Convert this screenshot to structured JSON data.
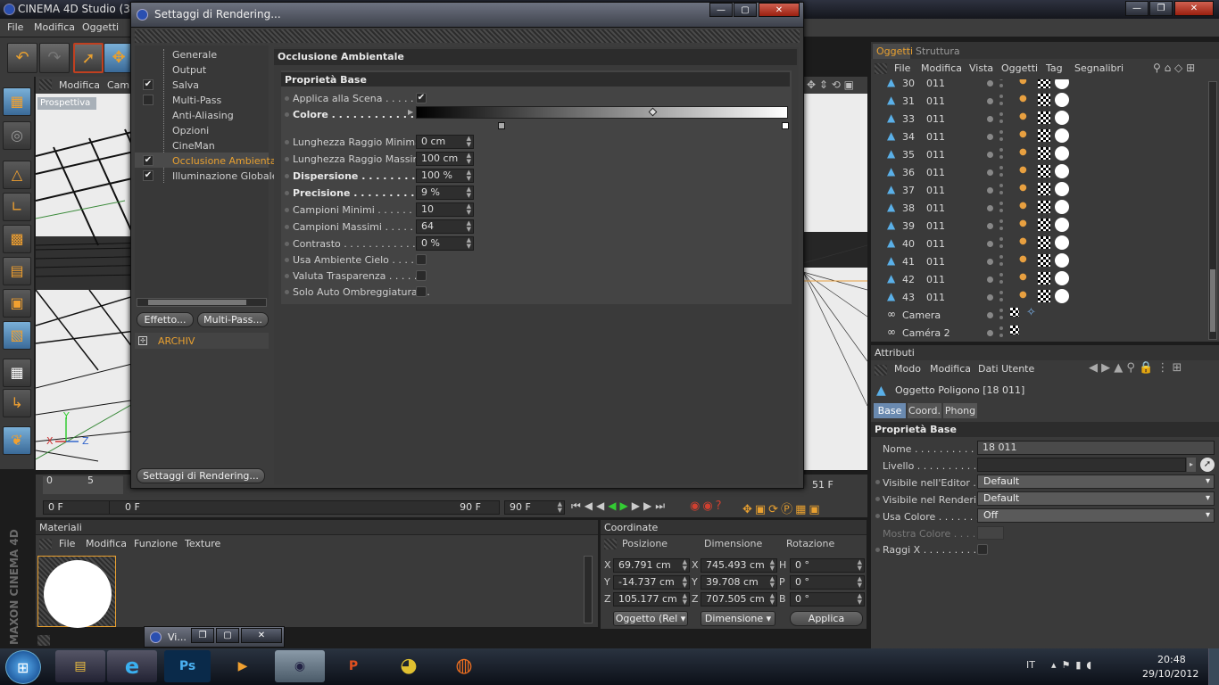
{
  "app": {
    "title": "CINEMA 4D Studio (32"
  },
  "menubar": [
    "File",
    "Modifica",
    "Oggetti"
  ],
  "viewport": {
    "menu": [
      "Modifica",
      "Cam"
    ],
    "label": "Prospettiva",
    "axes": {
      "x": "X",
      "y": "Y",
      "z": "Z"
    }
  },
  "dialog": {
    "title": "Settaggi di Rendering...",
    "nav": [
      {
        "label": "Generale",
        "checked": false,
        "active": false
      },
      {
        "label": "Output",
        "checked": false,
        "active": false
      },
      {
        "label": "Salva",
        "checked": true,
        "active": false
      },
      {
        "label": "Multi-Pass",
        "checked": false,
        "active": false,
        "box": true
      },
      {
        "label": "Anti-Aliasing",
        "checked": false,
        "active": false
      },
      {
        "label": "Opzioni",
        "checked": false,
        "active": false
      },
      {
        "label": "CineMan",
        "checked": false,
        "active": false
      },
      {
        "label": "Occlusione Ambientale",
        "checked": true,
        "active": true
      },
      {
        "label": "Illuminazione Globale",
        "checked": true,
        "active": false
      }
    ],
    "effect_button": "Effetto...",
    "multipass_button": "Multi-Pass...",
    "preset": "ARCHIV",
    "bottom_button": "Settaggi di Rendering...",
    "section_title": "Occlusione Ambientale",
    "group_title": "Proprietà Base",
    "props": {
      "applica": {
        "label": "Applica alla Scena . . . . . . .",
        "checked": true
      },
      "colore": {
        "label": "Colore . . . . . . . . . . . . . ."
      },
      "lung_min": {
        "label": "Lunghezza Raggio Minima",
        "value": "0 cm"
      },
      "lung_max": {
        "label": "Lunghezza Raggio Massima",
        "value": "100 cm"
      },
      "dispersione": {
        "label": "Dispersione . . . . . . . . . . .",
        "value": "100 %"
      },
      "precisione": {
        "label": "Precisione . . . . . . . . . . .",
        "value": "9 %"
      },
      "camp_min": {
        "label": "Campioni Minimi . . . . . . . . .",
        "value": "10"
      },
      "camp_max": {
        "label": "Campioni Massimi . . . . . . . .",
        "value": "64"
      },
      "contrasto": {
        "label": "Contrasto . . . . . . . . . . . . .",
        "value": "0 %"
      },
      "usa_cielo": {
        "label": "Usa Ambiente Cielo . . . . . .",
        "checked": false
      },
      "valuta_trasp": {
        "label": "Valuta Trasparenza . . . . . .",
        "checked": false
      },
      "solo_auto": {
        "label": "Solo Auto Ombreggiatura . .",
        "checked": false
      }
    }
  },
  "timeline": {
    "ticks": [
      "0",
      "5"
    ],
    "current": "0 F",
    "range_start": "0 F",
    "range_end": "90 F",
    "end": "90 F",
    "frame_right": "51 F"
  },
  "materials": {
    "title": "Materiali",
    "menu": [
      "File",
      "Modifica",
      "Funzione",
      "Texture"
    ]
  },
  "coordinates": {
    "title": "Coordinate",
    "headers": [
      "Posizione",
      "Dimensione",
      "Rotazione"
    ],
    "rows": [
      {
        "axis": "X",
        "pos": "69.791 cm",
        "daxis": "X",
        "dim": "745.493 cm",
        "raxis": "H",
        "rot": "0 °"
      },
      {
        "axis": "Y",
        "pos": "-14.737 cm",
        "daxis": "Y",
        "dim": "39.708 cm",
        "raxis": "P",
        "rot": "0 °"
      },
      {
        "axis": "Z",
        "pos": "105.177 cm",
        "daxis": "Z",
        "dim": "707.505 cm",
        "raxis": "B",
        "rot": "0 °"
      }
    ],
    "mode1": "Oggetto (Rel",
    "mode2": "Dimensione",
    "apply": "Applica"
  },
  "objects": {
    "tabs": [
      "Oggetti",
      "Struttura"
    ],
    "menu": [
      "File",
      "Modifica",
      "Vista",
      "Oggetti",
      "Tag",
      "Segnalibri"
    ],
    "rows": [
      {
        "num": "30",
        "name": "011"
      },
      {
        "num": "31",
        "name": "011"
      },
      {
        "num": "33",
        "name": "011"
      },
      {
        "num": "34",
        "name": "011"
      },
      {
        "num": "35",
        "name": "011"
      },
      {
        "num": "36",
        "name": "011"
      },
      {
        "num": "37",
        "name": "011"
      },
      {
        "num": "38",
        "name": "011"
      },
      {
        "num": "39",
        "name": "011"
      },
      {
        "num": "40",
        "name": "011"
      },
      {
        "num": "41",
        "name": "011"
      },
      {
        "num": "42",
        "name": "011"
      },
      {
        "num": "43",
        "name": "011"
      }
    ],
    "cameras": [
      "Camera",
      "Caméra 2"
    ]
  },
  "attributes": {
    "title": "Attributi",
    "menu": [
      "Modo",
      "Modifica",
      "Dati Utente"
    ],
    "object": "Oggetto Poligono [18    011]",
    "tabs": [
      "Base",
      "Coord.",
      "Phong"
    ],
    "group": "Proprietà Base",
    "nome_label": "Nome . . . . . . . . . . . . . .",
    "nome": "18    011",
    "livello_label": "Livello . . . . . . . . . . . . .",
    "vis_editor_label": "Visibile nell'Editor . . .",
    "vis_editor": "Default",
    "vis_render_label": "Visibile nel Rendering",
    "vis_render": "Default",
    "usa_colore_label": "Usa Colore . . . . . . . . .",
    "usa_colore": "Off",
    "mostra_colore_label": "Mostra Colore . . . . . .",
    "raggi_label": "Raggi X . . . . . . . . . . ."
  },
  "mini_window": {
    "title": "Vi..."
  },
  "brand": "MAXON CINEMA 4D",
  "taskbar": {
    "lang": "IT",
    "time": "20:48",
    "date": "29/10/2012"
  }
}
